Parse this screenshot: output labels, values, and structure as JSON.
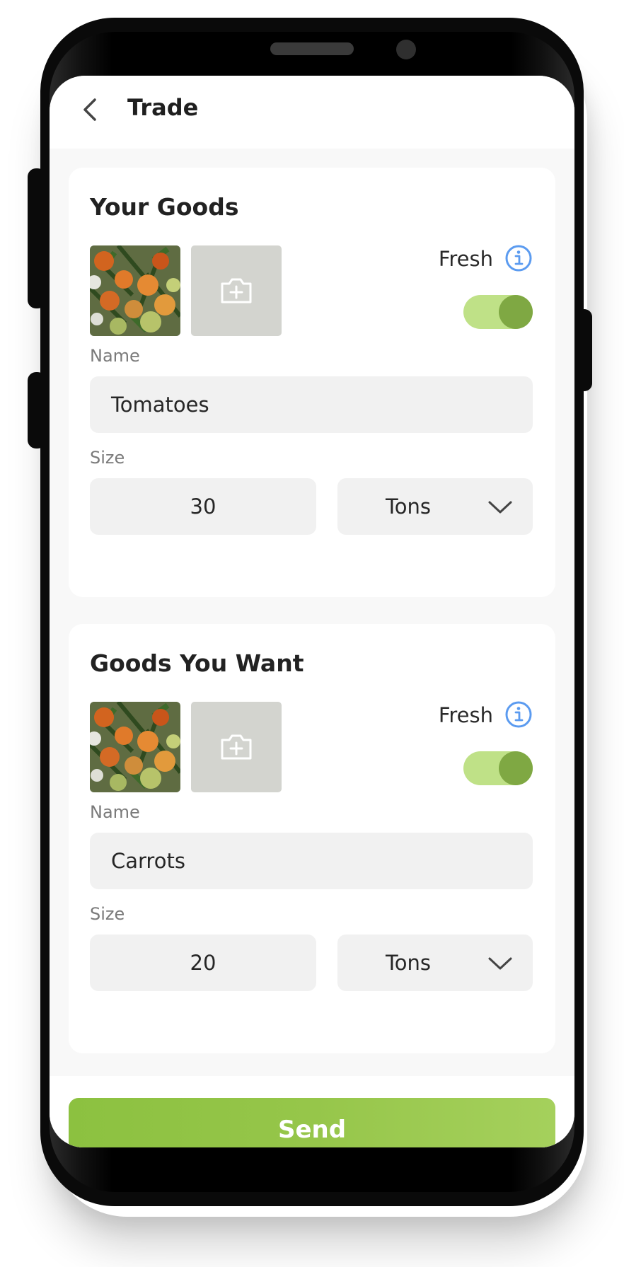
{
  "header": {
    "title": "Trade",
    "back_icon": "chevron-left-icon"
  },
  "cards": [
    {
      "title": "Your Goods",
      "fresh_label": "Fresh",
      "fresh_on": true,
      "name_label": "Name",
      "name_value": "Tomatoes",
      "size_label": "Size",
      "size_value": "30",
      "unit_value": "Tons"
    },
    {
      "title": "Goods You Want",
      "fresh_label": "Fresh",
      "fresh_on": true,
      "name_label": "Name",
      "name_value": "Carrots",
      "size_label": "Size",
      "size_value": "20",
      "unit_value": "Tons"
    }
  ],
  "send_label": "Send",
  "colors": {
    "accent_green": "#8cc140",
    "toggle_track": "#bfe187",
    "toggle_knob": "#7fa843",
    "info_blue": "#5b9bf0",
    "placeholder_gray": "#d3d4cf"
  }
}
